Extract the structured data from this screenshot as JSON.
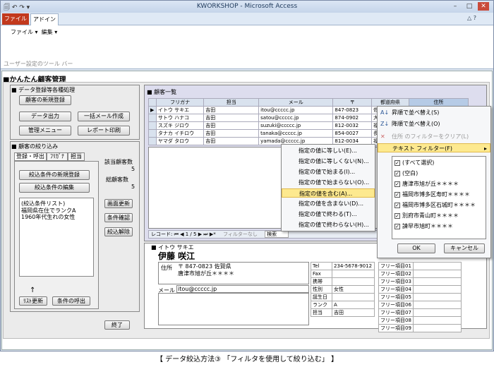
{
  "window": {
    "title": "KWORKSHOP - Microsoft Access"
  },
  "ribbon": {
    "tab_file": "ファイル",
    "tab_addin": "アドイン",
    "menu_file": "ファイル ▾",
    "menu_edit": "編集 ▾",
    "group_label": "ユーザー設定のツール バー"
  },
  "form": {
    "title": "■かんたん顧客管理"
  },
  "left": {
    "section1": "■ データ登録等各種処理",
    "btn_new": "顧客の新規登録",
    "btn_export": "データ出力",
    "btn_mail": "一括メール作成",
    "btn_menu": "管理メニュー",
    "btn_report": "レポート印刷",
    "section2": "■ 顧客の絞り込み",
    "tabs": [
      "登録・呼出",
      "ﾌﾘｶﾞﾅ",
      "担当"
    ],
    "btn_cond_new": "絞込条件の新規登録",
    "btn_cond_edit": "絞込条件の編集",
    "list_title": "(絞込条件リスト)",
    "list_items": [
      "福岡県在住でランクA",
      "1960年代生れの女性"
    ],
    "arrow": "↑",
    "btn_list_refresh": "ﾘｽﾄ更新",
    "btn_cond_call": "条件の呼出",
    "match_label": "該当顧客数",
    "match_count": "5",
    "total_label": "総顧客数",
    "total_count": "5",
    "btn_screen": "画面更新",
    "btn_confirm": "条件確認",
    "btn_clear": "絞込解除",
    "btn_exit": "終了"
  },
  "list": {
    "title": "■ 顧客一覧",
    "headers": [
      "フリガナ",
      "担当",
      "メール",
      "〒",
      "都道府県",
      "住所"
    ],
    "rows": [
      [
        "イトウ サキエ",
        "吉田",
        "itou@ccccc.jp",
        "847-0823",
        "佐賀"
      ],
      [
        "サトウ ハナコ",
        "吉田",
        "satou@ccccc.jp",
        "874-0902",
        "大分"
      ],
      [
        "スズキ ジロウ",
        "吉田",
        "suzuki@ccccc.jp",
        "812-0032",
        "福岡"
      ],
      [
        "タナカ イチロウ",
        "吉田",
        "tanaka@ccccc.jp",
        "854-0027",
        "長崎"
      ],
      [
        "ヤマダ タロウ",
        "吉田",
        "yamada@ccccc.jp",
        "812-0034",
        "福岡"
      ]
    ],
    "nav_record": "レコード:",
    "nav_pos": "1 / 5",
    "nav_filter": "フィルターなし",
    "nav_search": "検索"
  },
  "text_menu": [
    "指定の値に等しい(E)...",
    "指定の値に等しくない(N)...",
    "指定の値で始まる(I)...",
    "指定の値で始まらない(O)...",
    "指定の値を含む(A)...",
    "指定の値を含まない(D)...",
    "指定の値で終わる(T)...",
    "指定の値で終わらない(H)..."
  ],
  "sort_menu": {
    "asc": "昇順で並べ替え(S)",
    "desc": "降順で並べ替え(O)",
    "clear": "住所 のフィルターをクリア(L)",
    "text_filter": "テキスト フィルター(F)",
    "options": [
      "(すべて選択)",
      "(空白)",
      "唐津市旭が丘＊＊＊＊",
      "福岡市博多区寿町＊＊＊＊",
      "福岡市博多区石城町＊＊＊＊",
      "別府市青山町＊＊＊＊",
      "諫早市旭町＊＊＊＊"
    ],
    "ok": "OK",
    "cancel": "キャンセル"
  },
  "detail": {
    "furigana": "■ イトウ サキエ",
    "name": "伊藤 咲江",
    "addr_label": "住所",
    "zip": "〒 847-0823 佐賀県",
    "addr": "唐津市旭が丘＊＊＊＊",
    "mail_label": "メール",
    "mail": "itou@ccccc.jp",
    "memo_label": "メモ",
    "right_labels": [
      "Tel",
      "Fax",
      "携帯",
      "性別",
      "誕生日",
      "ランク",
      "担当"
    ],
    "right_values": [
      "234-5678-9012",
      "",
      "",
      "女性",
      "",
      "A",
      "吉田"
    ],
    "free": [
      "フリー項目01",
      "フリー項目02",
      "フリー項目03",
      "フリー項目04",
      "フリー項目05",
      "フリー項目06",
      "フリー項目07",
      "フリー項目08",
      "フリー項目09"
    ]
  },
  "caption": "【 データ絞込方法③ 「フィルタを使用して絞り込む」 】"
}
